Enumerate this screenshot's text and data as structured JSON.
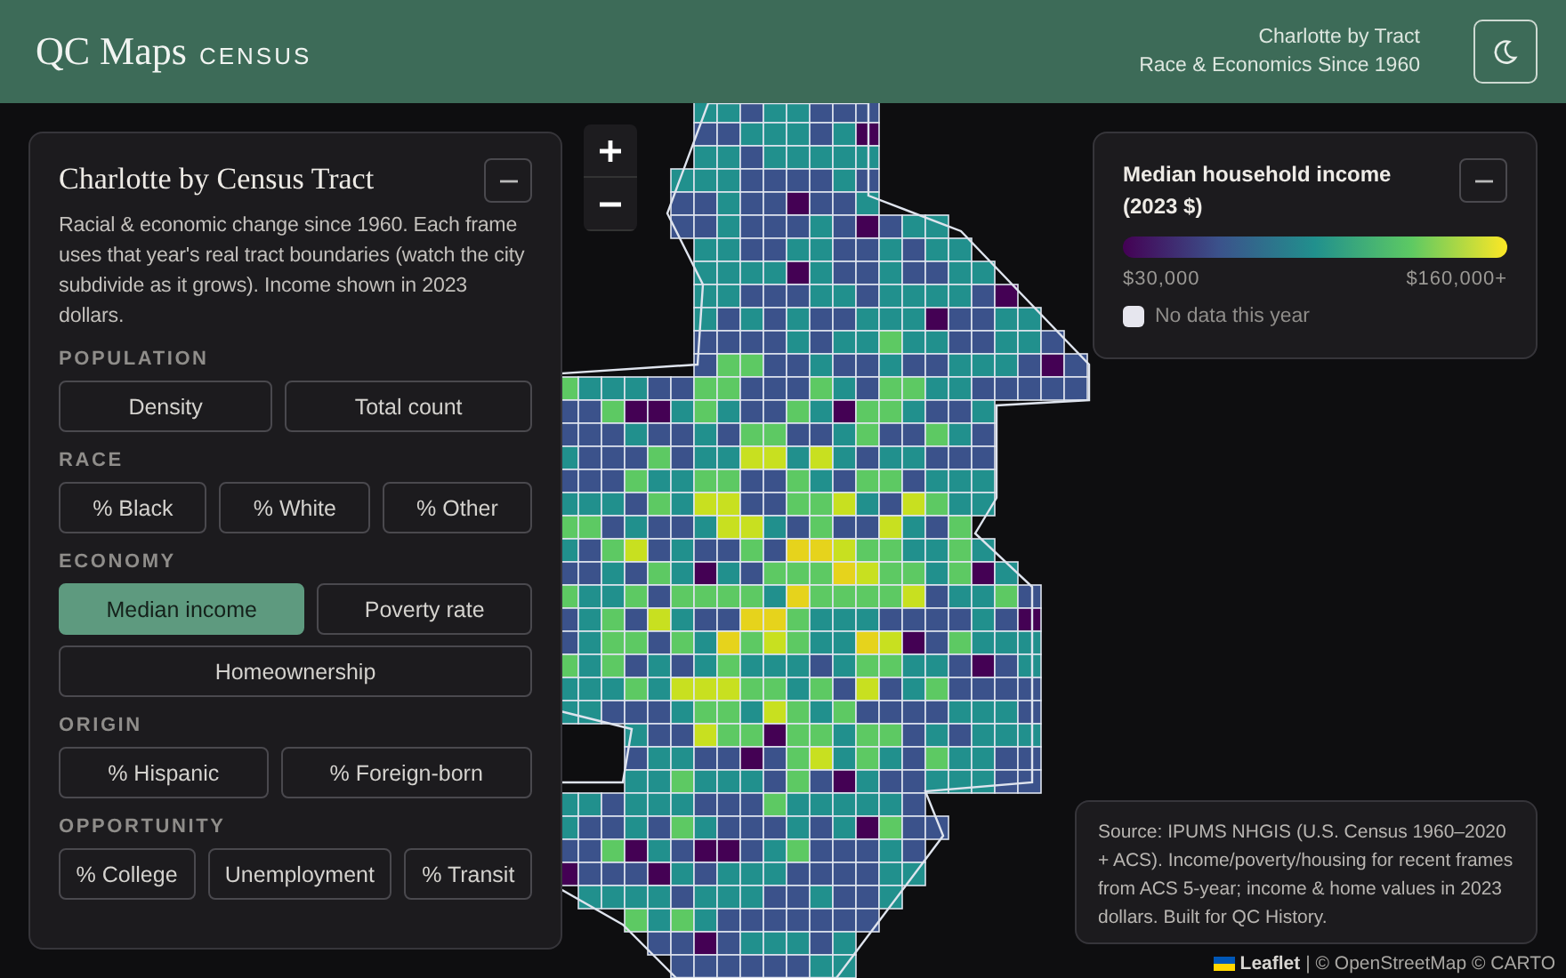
{
  "header": {
    "brand": "QC Maps",
    "brand_sub": "CENSUS",
    "subtitle_line_1": "Charlotte by Tract",
    "subtitle_line_2": "Race & Economics Since 1960"
  },
  "panel": {
    "title": "Charlotte by Census Tract",
    "description": "Racial & economic change since 1960. Each frame uses that year's real tract boundaries (watch the city subdivide as it grows). Income shown in 2023 dollars.",
    "groups": [
      {
        "label": "POPULATION",
        "buttons": [
          {
            "label": "Density",
            "selected": false
          },
          {
            "label": "Total count",
            "selected": false
          }
        ]
      },
      {
        "label": "RACE",
        "buttons": [
          {
            "label": "% Black",
            "selected": false
          },
          {
            "label": "% White",
            "selected": false
          },
          {
            "label": "% Other",
            "selected": false
          }
        ]
      },
      {
        "label": "ECONOMY",
        "buttons": [
          {
            "label": "Median income",
            "selected": true
          },
          {
            "label": "Poverty rate",
            "selected": false
          },
          {
            "label": "Homeownership",
            "selected": false
          }
        ]
      },
      {
        "label": "ORIGIN",
        "buttons": [
          {
            "label": "% Hispanic",
            "selected": false
          },
          {
            "label": "% Foreign-born",
            "selected": false
          }
        ]
      },
      {
        "label": "OPPORTUNITY",
        "buttons": [
          {
            "label": "% College",
            "selected": false
          },
          {
            "label": "Unemployment",
            "selected": false
          },
          {
            "label": "% Transit",
            "selected": false
          }
        ]
      }
    ]
  },
  "legend": {
    "title": "Median household income (2023 $)",
    "min_label": "$30,000",
    "max_label": "$160,000+",
    "no_data_label": "No data this year"
  },
  "source": "Source: IPUMS NHGIS (U.S. Census 1960–2020 + ACS). Income/poverty/housing for recent frames from ACS 5-year; income & home values in 2023 dollars. Built for QC History.",
  "attribution": {
    "link": "Leaflet",
    "text": "| © OpenStreetMap © CARTO"
  }
}
